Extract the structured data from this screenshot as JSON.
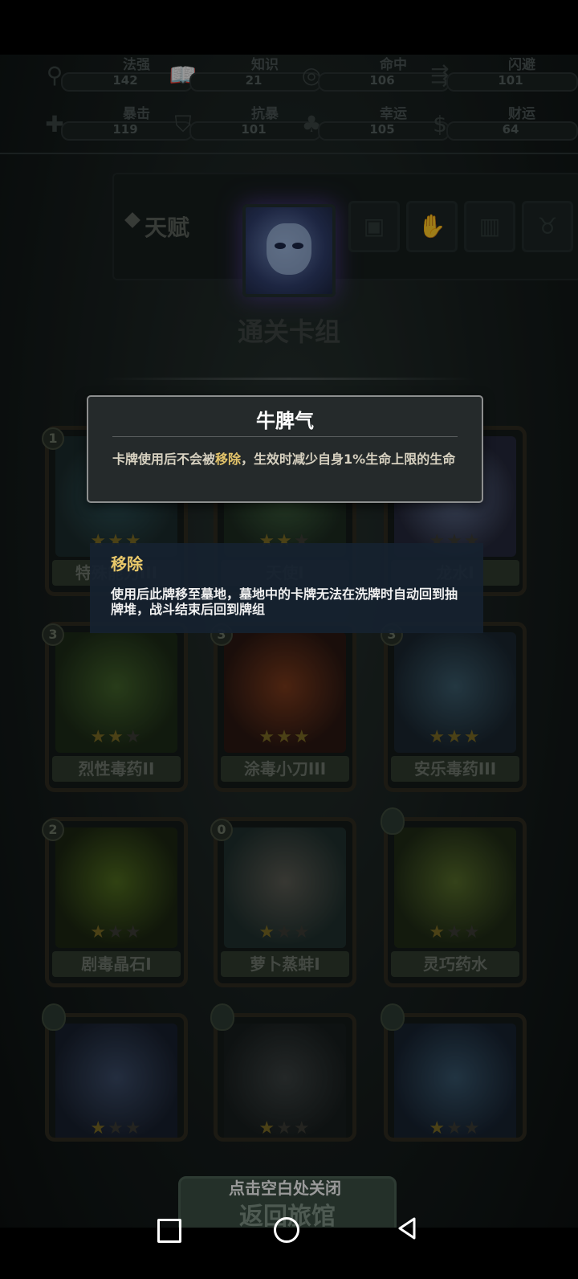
{
  "stats": [
    {
      "label": "法强",
      "value": "142",
      "icon": "magic-icon"
    },
    {
      "label": "知识",
      "value": "21",
      "icon": "book-icon"
    },
    {
      "label": "命中",
      "value": "106",
      "icon": "target-icon"
    },
    {
      "label": "闪避",
      "value": "101",
      "icon": "dodge-icon"
    },
    {
      "label": "暴击",
      "value": "119",
      "icon": "crit-icon"
    },
    {
      "label": "抗暴",
      "value": "101",
      "icon": "shield-icon"
    },
    {
      "label": "幸运",
      "value": "105",
      "icon": "clover-icon"
    },
    {
      "label": "财运",
      "value": "64",
      "icon": "money-icon"
    }
  ],
  "talent": {
    "label": "天赋"
  },
  "deck": {
    "title": "通关卡组"
  },
  "cards": [
    {
      "cost": "1",
      "name": "特殊能力III",
      "stars": 3
    },
    {
      "cost": "",
      "name": "天使I",
      "stars": 2
    },
    {
      "cost": "",
      "name": "龙水I",
      "stars": 0
    },
    {
      "cost": "3",
      "name": "烈性毒药II",
      "stars": 2
    },
    {
      "cost": "3",
      "name": "涂毒小刀III",
      "stars": 3
    },
    {
      "cost": "3",
      "name": "安乐毒药III",
      "stars": 3
    },
    {
      "cost": "2",
      "name": "剧毒晶石I",
      "stars": 1
    },
    {
      "cost": "0",
      "name": "萝卜蒸蚌I",
      "stars": 1
    },
    {
      "cost": "",
      "name": "灵巧药水",
      "stars": 1
    },
    {
      "cost": "",
      "name": "",
      "stars": 1
    },
    {
      "cost": "",
      "name": "",
      "stars": 1
    },
    {
      "cost": "",
      "name": "",
      "stars": 1
    }
  ],
  "tooltip": {
    "title": "牛脾气",
    "desc_pre": "卡牌使用后不会被",
    "desc_keyword": "移除",
    "desc_post": "，生效时减少自身1%生命上限的生命"
  },
  "keyword_tip": {
    "title": "移除",
    "desc": "使用后此牌移至墓地，墓地中的卡牌无法在洗牌时自动回到抽牌堆，战斗结束后回到牌组"
  },
  "bottom": {
    "close_hint": "点击空白处关闭",
    "return_label": "返回旅馆"
  }
}
